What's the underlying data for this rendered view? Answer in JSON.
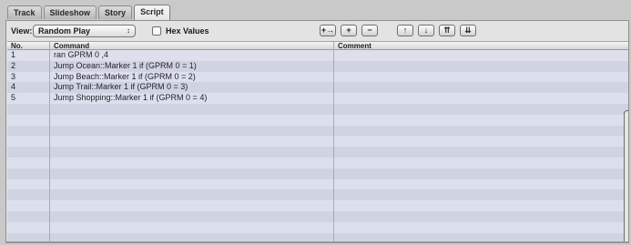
{
  "tabs": [
    {
      "label": "Track",
      "active": false
    },
    {
      "label": "Slideshow",
      "active": false
    },
    {
      "label": "Story",
      "active": false
    },
    {
      "label": "Script",
      "active": true
    }
  ],
  "toolbar": {
    "view_label": "View:",
    "view_value": "Random Play",
    "popup_arrows": "↕",
    "hex_label": "Hex Values",
    "hex_checked": false,
    "buttons": [
      {
        "name": "insert-command-button",
        "glyph": "+→"
      },
      {
        "name": "add-command-button",
        "glyph": "+"
      },
      {
        "name": "remove-command-button",
        "glyph": "−"
      },
      {
        "name": "move-up-button",
        "glyph": "↑"
      },
      {
        "name": "move-down-button",
        "glyph": "↓"
      },
      {
        "name": "move-to-top-button",
        "glyph": "⇈"
      },
      {
        "name": "move-to-bottom-button",
        "glyph": "⇊"
      }
    ]
  },
  "table": {
    "headers": {
      "no": "No.",
      "command": "Command",
      "comment": "Comment"
    },
    "rows": [
      {
        "no": "1",
        "command": "ran GPRM 0 ,4",
        "comment": ""
      },
      {
        "no": "2",
        "command": "Jump Ocean::Marker 1 if (GPRM 0 = 1)",
        "comment": ""
      },
      {
        "no": "3",
        "command": "Jump Beach::Marker 1 if (GPRM 0 = 2)",
        "comment": ""
      },
      {
        "no": "4",
        "command": "Jump Trail::Marker 1 if (GPRM 0 = 3)",
        "comment": ""
      },
      {
        "no": "5",
        "command": "Jump Shopping::Marker 1 if (GPRM 0 = 4)",
        "comment": ""
      },
      {
        "no": "",
        "command": "",
        "comment": ""
      },
      {
        "no": "",
        "command": "",
        "comment": ""
      },
      {
        "no": "",
        "command": "",
        "comment": ""
      },
      {
        "no": "",
        "command": "",
        "comment": ""
      },
      {
        "no": "",
        "command": "",
        "comment": ""
      },
      {
        "no": "",
        "command": "",
        "comment": ""
      },
      {
        "no": "",
        "command": "",
        "comment": ""
      },
      {
        "no": "",
        "command": "",
        "comment": ""
      },
      {
        "no": "",
        "command": "",
        "comment": ""
      },
      {
        "no": "",
        "command": "",
        "comment": ""
      },
      {
        "no": "",
        "command": "",
        "comment": ""
      },
      {
        "no": "",
        "command": "",
        "comment": ""
      },
      {
        "no": "",
        "command": "",
        "comment": ""
      }
    ]
  }
}
